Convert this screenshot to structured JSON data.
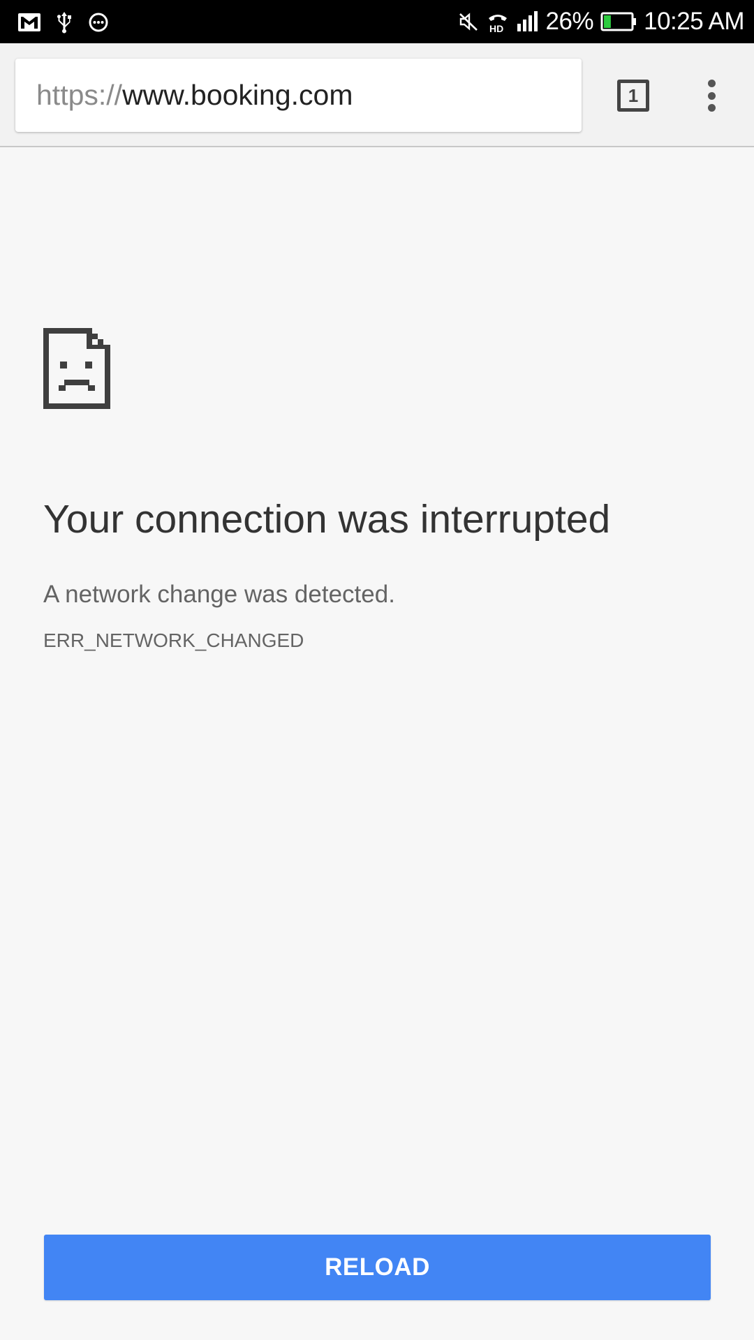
{
  "status_bar": {
    "left_icons": [
      "gmail-icon",
      "usb-icon",
      "messenger-icon"
    ],
    "right_icons": [
      "mute-icon",
      "hd-call-icon",
      "signal-icon",
      "battery-icon"
    ],
    "battery": "26%",
    "time": "10:25 AM",
    "battery_color": "#2ecc40"
  },
  "toolbar": {
    "url_scheme": "https://",
    "url_host": "www.booking.com",
    "tab_count": "1",
    "menu_icon": "more-vert-icon"
  },
  "error": {
    "icon": "sad-page-icon",
    "title": "Your connection was interrupted",
    "description": "A network change was detected.",
    "code": "ERR_NETWORK_CHANGED"
  },
  "actions": {
    "reload_label": "RELOAD",
    "accent": "#4285f4"
  }
}
